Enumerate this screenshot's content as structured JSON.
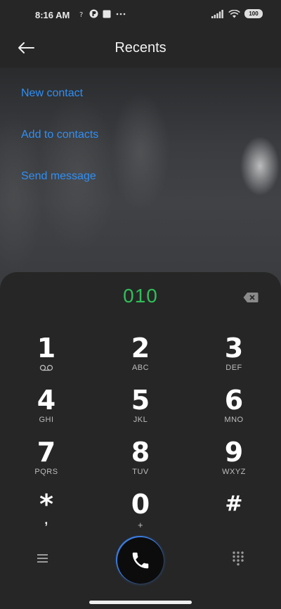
{
  "status_bar": {
    "time": "8:16 AM",
    "battery": "100"
  },
  "header": {
    "title": "Recents"
  },
  "actions": [
    {
      "label": "New contact"
    },
    {
      "label": "Add to contacts"
    },
    {
      "label": "Send message"
    }
  ],
  "dialer": {
    "number": "010",
    "keys": [
      {
        "digit": "1",
        "letters": ""
      },
      {
        "digit": "2",
        "letters": "ABC"
      },
      {
        "digit": "3",
        "letters": "DEF"
      },
      {
        "digit": "4",
        "letters": "GHI"
      },
      {
        "digit": "5",
        "letters": "JKL"
      },
      {
        "digit": "6",
        "letters": "MNO"
      },
      {
        "digit": "7",
        "letters": "PQRS"
      },
      {
        "digit": "8",
        "letters": "TUV"
      },
      {
        "digit": "9",
        "letters": "WXYZ"
      },
      {
        "digit": "*",
        "letters": ","
      },
      {
        "digit": "0",
        "letters": "+"
      },
      {
        "digit": "#",
        "letters": ""
      }
    ]
  },
  "colors": {
    "accent_link": "#2f8ff5",
    "dial_number": "#2fbf59",
    "call_ring": "#3a7be0"
  },
  "icons": {
    "back": "arrow-left-icon",
    "backspace": "backspace-icon",
    "voicemail": "voicemail-icon",
    "menu": "menu-icon",
    "call": "phone-icon",
    "keypad": "dialpad-icon"
  }
}
